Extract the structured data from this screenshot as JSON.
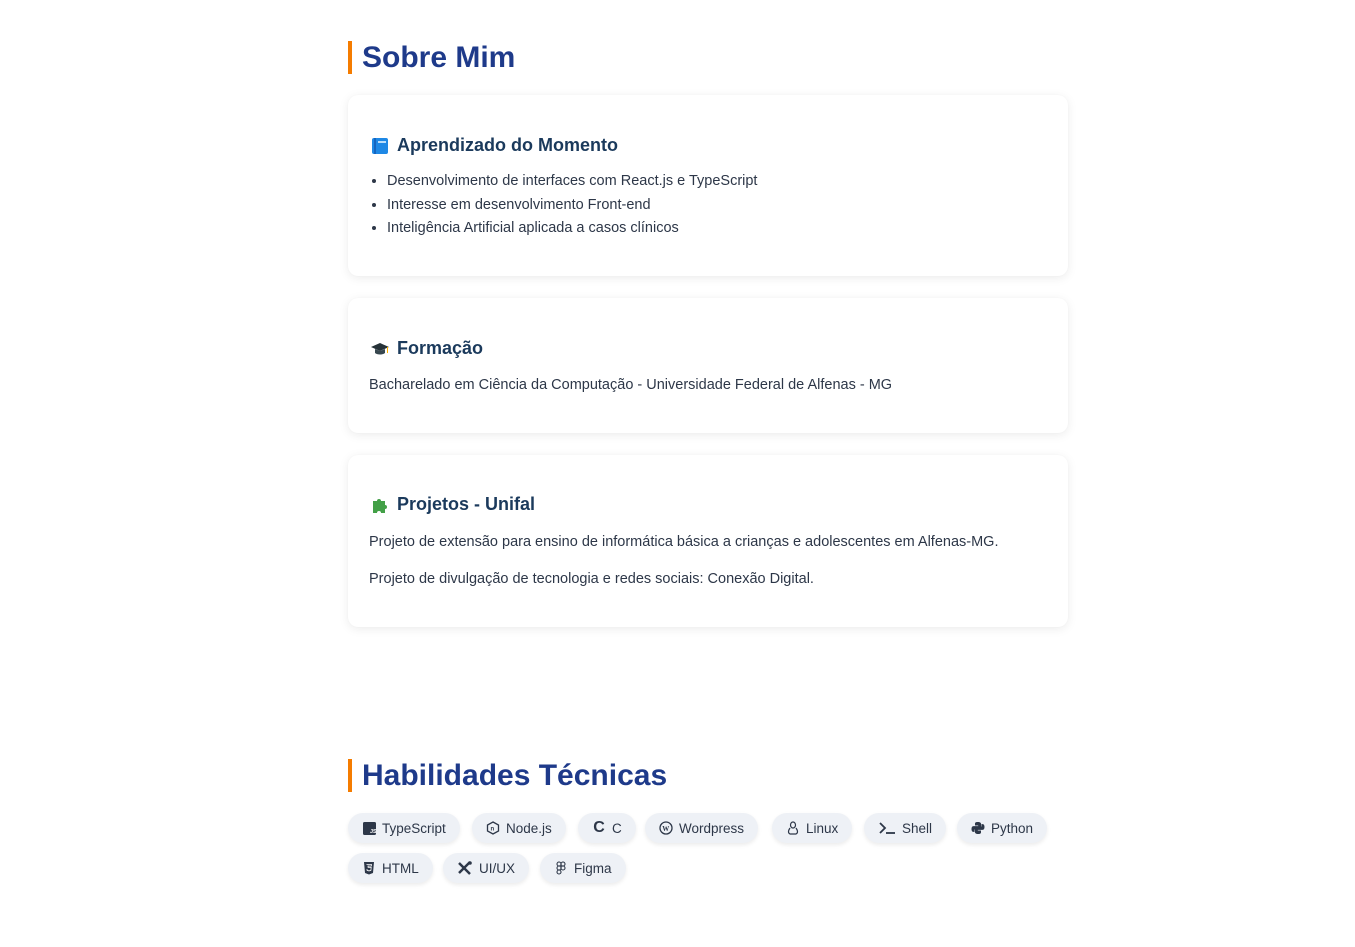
{
  "about": {
    "title": "Sobre Mim",
    "learning": {
      "icon": "blue-book-icon",
      "title": "Aprendizado do Momento",
      "items": [
        "Desenvolvimento de interfaces com React.js e TypeScript",
        "Interesse em desenvolvimento Front-end",
        "Inteligência Artificial aplicada a casos clínicos"
      ]
    },
    "education": {
      "icon": "graduation-cap-icon",
      "title": "Formação",
      "text": "Bacharelado em Ciência da Computação - Universidade Federal de Alfenas - MG"
    },
    "projects": {
      "icon": "puzzle-piece-icon",
      "title": "Projetos - Unifal",
      "paragraphs": [
        "Projeto de extensão para ensino de informática básica a crianças e adolescentes em Alfenas-MG.",
        "Projeto de divulgação de tecnologia e redes sociais: Conexão Digital."
      ]
    }
  },
  "skills": {
    "title": "Habilidades Técnicas",
    "chips": [
      {
        "label": "TypeScript",
        "icon": "js-icon"
      },
      {
        "label": "Node.js",
        "icon": "nodejs-icon"
      },
      {
        "label": "C",
        "icon": "c-icon"
      },
      {
        "label": "Wordpress",
        "icon": "wordpress-icon"
      },
      {
        "label": "Linux",
        "icon": "linux-icon"
      },
      {
        "label": "Shell",
        "icon": "terminal-icon"
      },
      {
        "label": "Python",
        "icon": "python-icon"
      },
      {
        "label": "HTML",
        "icon": "html5-icon"
      },
      {
        "label": "UI/UX",
        "icon": "design-tools-icon"
      },
      {
        "label": "Figma",
        "icon": "figma-icon"
      }
    ]
  }
}
